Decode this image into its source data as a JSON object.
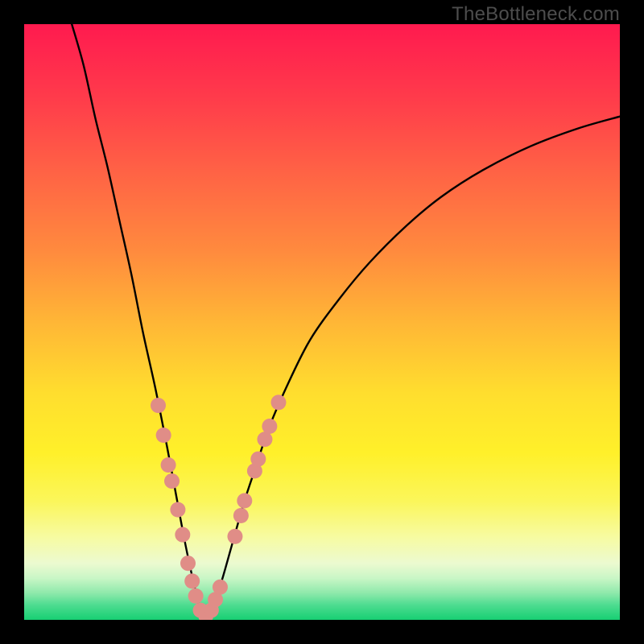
{
  "attribution": "TheBottleneck.com",
  "colors": {
    "background": "#000000",
    "curve_stroke": "#000000",
    "marker_fill": "#e08d87",
    "attribution_text": "#4d4d4d"
  },
  "gradient_stops": [
    {
      "offset": 0.0,
      "color": "#ff1a4f"
    },
    {
      "offset": 0.12,
      "color": "#ff3a4b"
    },
    {
      "offset": 0.25,
      "color": "#ff6345"
    },
    {
      "offset": 0.38,
      "color": "#ff8a3e"
    },
    {
      "offset": 0.5,
      "color": "#ffb636"
    },
    {
      "offset": 0.62,
      "color": "#ffde2e"
    },
    {
      "offset": 0.72,
      "color": "#fff02a"
    },
    {
      "offset": 0.8,
      "color": "#fbf65a"
    },
    {
      "offset": 0.86,
      "color": "#f7fba0"
    },
    {
      "offset": 0.905,
      "color": "#ecfad0"
    },
    {
      "offset": 0.93,
      "color": "#c9f6c6"
    },
    {
      "offset": 0.955,
      "color": "#8ee9ab"
    },
    {
      "offset": 0.975,
      "color": "#4edc90"
    },
    {
      "offset": 1.0,
      "color": "#17cf73"
    }
  ],
  "chart_data": {
    "type": "line",
    "title": "",
    "xlabel": "",
    "ylabel": "",
    "xlim": [
      0,
      100
    ],
    "ylim": [
      0,
      100
    ],
    "grid": false,
    "series": [
      {
        "name": "bottleneck-curve",
        "x": [
          8,
          10,
          12,
          14,
          16,
          18,
          20,
          22,
          24,
          25.5,
          27,
          28.5,
          29.5,
          30.5,
          31.5,
          33,
          35,
          37,
          39,
          41,
          44,
          48,
          53,
          58,
          64,
          70,
          77,
          85,
          93,
          100
        ],
        "y": [
          100,
          93,
          84,
          76,
          67,
          58,
          48,
          39,
          29,
          21,
          13,
          6,
          2,
          0.5,
          2,
          6,
          13,
          20,
          26,
          32,
          39,
          47,
          54,
          60,
          66,
          71,
          75.5,
          79.5,
          82.5,
          84.5
        ]
      }
    ],
    "markers": {
      "name": "highlight-dots",
      "points": [
        {
          "x": 22.5,
          "y": 36
        },
        {
          "x": 23.4,
          "y": 31
        },
        {
          "x": 24.2,
          "y": 26
        },
        {
          "x": 24.8,
          "y": 23.3
        },
        {
          "x": 25.8,
          "y": 18.5
        },
        {
          "x": 26.6,
          "y": 14.3
        },
        {
          "x": 27.5,
          "y": 9.5
        },
        {
          "x": 28.2,
          "y": 6.5
        },
        {
          "x": 28.8,
          "y": 4
        },
        {
          "x": 29.6,
          "y": 1.6
        },
        {
          "x": 30.5,
          "y": 0.7
        },
        {
          "x": 31.4,
          "y": 1.6
        },
        {
          "x": 32.1,
          "y": 3.4
        },
        {
          "x": 32.9,
          "y": 5.5
        },
        {
          "x": 35.4,
          "y": 14
        },
        {
          "x": 36.4,
          "y": 17.5
        },
        {
          "x": 37.0,
          "y": 20
        },
        {
          "x": 38.7,
          "y": 25
        },
        {
          "x": 39.3,
          "y": 27
        },
        {
          "x": 40.4,
          "y": 30.3
        },
        {
          "x": 41.2,
          "y": 32.5
        },
        {
          "x": 42.7,
          "y": 36.5
        }
      ]
    }
  }
}
